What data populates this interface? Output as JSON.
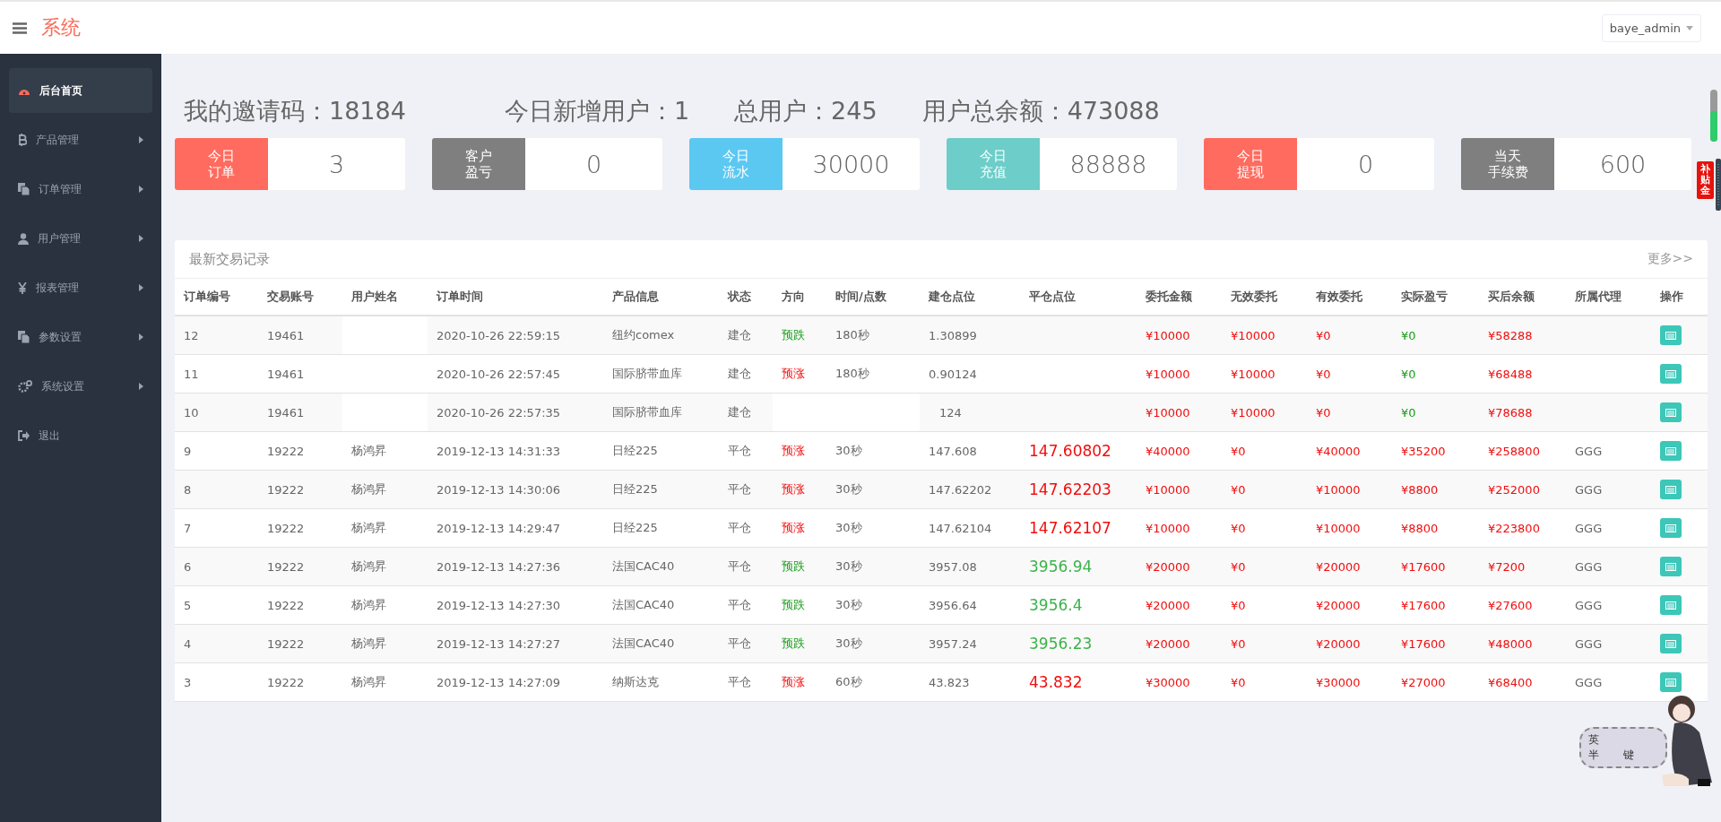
{
  "header": {
    "title": "系统",
    "user_menu": "baye_admin"
  },
  "sidebar": {
    "items": [
      {
        "label": "后台首页",
        "kind": "dashboard",
        "selected": true,
        "has_submenu": false
      },
      {
        "label": "产品管理",
        "kind": "bitcoin",
        "selected": false,
        "has_submenu": true
      },
      {
        "label": "订单管理",
        "kind": "files",
        "selected": false,
        "has_submenu": true
      },
      {
        "label": "用户管理",
        "kind": "user",
        "selected": false,
        "has_submenu": true
      },
      {
        "label": "报表管理",
        "kind": "yen",
        "selected": false,
        "has_submenu": true
      },
      {
        "label": "参数设置",
        "kind": "files",
        "selected": false,
        "has_submenu": true
      },
      {
        "label": "系统设置",
        "kind": "gears",
        "selected": false,
        "has_submenu": true
      },
      {
        "label": "退出",
        "kind": "exit",
        "selected": false,
        "has_submenu": false
      }
    ]
  },
  "summary": [
    {
      "label": "我的邀请码：",
      "value": "18184"
    },
    {
      "label": "今日新增用户：",
      "value": "1"
    },
    {
      "label": "总用户：",
      "value": "245"
    },
    {
      "label": "用户总余额：",
      "value": "473088"
    }
  ],
  "stat_cards": [
    {
      "label_lines": [
        "今日",
        "订单"
      ],
      "value": "3",
      "color": "#ff6b5e"
    },
    {
      "label_lines": [
        "客户",
        "盈亏"
      ],
      "value": "0",
      "color": "#7f7f7f"
    },
    {
      "label_lines": [
        "今日",
        "流水"
      ],
      "value": "30000",
      "color": "#5bc8f2"
    },
    {
      "label_lines": [
        "今日",
        "充值"
      ],
      "value": "88888",
      "color": "#6ccdc9"
    },
    {
      "label_lines": [
        "今日",
        "提现"
      ],
      "value": "0",
      "color": "#ff6b5e"
    },
    {
      "label_lines": [
        "当天",
        "手续费"
      ],
      "value": "600",
      "color": "#7f7f7f"
    }
  ],
  "trades": {
    "title": "最新交易记录",
    "more_link": "更多>>",
    "columns": [
      "订单编号",
      "交易账号",
      "用户姓名",
      "订单时间",
      "产品信息",
      "状态",
      "方向",
      "时间/点数",
      "建仓点位",
      "平仓点位",
      "委托金额",
      "无效委托",
      "有效委托",
      "实际盈亏",
      "买后余额",
      "所属代理",
      "操作"
    ],
    "rows": [
      {
        "id": "12",
        "account": "19461",
        "time": "2020-10-26 22:59:15",
        "product": "纽约comex",
        "status": "建仓",
        "direction": {
          "label": "预跌",
          "kind": "down"
        },
        "duration": "180秒",
        "open": "1.30899",
        "entrust": "¥10000",
        "invalid": "¥10000",
        "valid": "¥0",
        "profit": {
          "value": "¥0",
          "kind": "down"
        },
        "balance": "¥58288"
      },
      {
        "id": "11",
        "account": "19461",
        "time": "2020-10-26 22:57:45",
        "product": "国际脐带血库",
        "status": "建仓",
        "direction": {
          "label": "预涨",
          "kind": "up"
        },
        "duration": "180秒",
        "open": "0.90124",
        "entrust": "¥10000",
        "invalid": "¥10000",
        "valid": "¥0",
        "profit": {
          "value": "¥0",
          "kind": "down"
        },
        "balance": "¥68488"
      },
      {
        "id": "10",
        "account": "19461",
        "time": "2020-10-26 22:57:35",
        "product": "国际脐带血库",
        "status": "建仓",
        "open": "124",
        "entrust": "¥10000",
        "invalid": "¥10000",
        "valid": "¥0",
        "profit": {
          "value": "¥0",
          "kind": "down"
        },
        "balance": "¥78688"
      },
      {
        "id": "9",
        "account": "19222",
        "name": "杨鸿昇",
        "time": "2019-12-13 14:31:33",
        "product": "日经225",
        "status": "平仓",
        "direction": {
          "label": "预涨",
          "kind": "up"
        },
        "duration": "30秒",
        "open": "147.608",
        "close": {
          "value": "147.60802",
          "kind": "up"
        },
        "entrust": "¥40000",
        "invalid": "¥0",
        "valid": "¥40000",
        "profit": {
          "value": "¥35200",
          "kind": "up"
        },
        "balance": "¥258800",
        "agent": "GGG"
      },
      {
        "id": "8",
        "account": "19222",
        "name": "杨鸿昇",
        "time": "2019-12-13 14:30:06",
        "product": "日经225",
        "status": "平仓",
        "direction": {
          "label": "预涨",
          "kind": "up"
        },
        "duration": "30秒",
        "open": "147.62202",
        "close": {
          "value": "147.62203",
          "kind": "up"
        },
        "entrust": "¥10000",
        "invalid": "¥0",
        "valid": "¥10000",
        "profit": {
          "value": "¥8800",
          "kind": "up"
        },
        "balance": "¥252000",
        "agent": "GGG"
      },
      {
        "id": "7",
        "account": "19222",
        "name": "杨鸿昇",
        "time": "2019-12-13 14:29:47",
        "product": "日经225",
        "status": "平仓",
        "direction": {
          "label": "预涨",
          "kind": "up"
        },
        "duration": "30秒",
        "open": "147.62104",
        "close": {
          "value": "147.62107",
          "kind": "up"
        },
        "entrust": "¥10000",
        "invalid": "¥0",
        "valid": "¥10000",
        "profit": {
          "value": "¥8800",
          "kind": "up"
        },
        "balance": "¥223800",
        "agent": "GGG"
      },
      {
        "id": "6",
        "account": "19222",
        "name": "杨鸿昇",
        "time": "2019-12-13 14:27:36",
        "product": "法国CAC40",
        "status": "平仓",
        "direction": {
          "label": "预跌",
          "kind": "down"
        },
        "duration": "30秒",
        "open": "3957.08",
        "close": {
          "value": "3956.94",
          "kind": "down"
        },
        "entrust": "¥20000",
        "invalid": "¥0",
        "valid": "¥20000",
        "profit": {
          "value": "¥17600",
          "kind": "up"
        },
        "balance": "¥7200",
        "agent": "GGG"
      },
      {
        "id": "5",
        "account": "19222",
        "name": "杨鸿昇",
        "time": "2019-12-13 14:27:30",
        "product": "法国CAC40",
        "status": "平仓",
        "direction": {
          "label": "预跌",
          "kind": "down"
        },
        "duration": "30秒",
        "open": "3956.64",
        "close": {
          "value": "3956.4",
          "kind": "down"
        },
        "entrust": "¥20000",
        "invalid": "¥0",
        "valid": "¥20000",
        "profit": {
          "value": "¥17600",
          "kind": "up"
        },
        "balance": "¥27600",
        "agent": "GGG"
      },
      {
        "id": "4",
        "account": "19222",
        "name": "杨鸿昇",
        "time": "2019-12-13 14:27:27",
        "product": "法国CAC40",
        "status": "平仓",
        "direction": {
          "label": "预跌",
          "kind": "down"
        },
        "duration": "30秒",
        "open": "3957.24",
        "close": {
          "value": "3956.23",
          "kind": "down"
        },
        "entrust": "¥20000",
        "invalid": "¥0",
        "valid": "¥20000",
        "profit": {
          "value": "¥17600",
          "kind": "up"
        },
        "balance": "¥48000",
        "agent": "GGG"
      },
      {
        "id": "3",
        "account": "19222",
        "name": "杨鸿昇",
        "time": "2019-12-13 14:27:09",
        "product": "纳斯达克",
        "status": "平仓",
        "direction": {
          "label": "预涨",
          "kind": "up"
        },
        "duration": "60秒",
        "open": "43.823",
        "close": {
          "value": "43.832",
          "kind": "up"
        },
        "entrust": "¥30000",
        "invalid": "¥0",
        "valid": "¥30000",
        "profit": {
          "value": "¥27000",
          "kind": "up"
        },
        "balance": "¥68400",
        "agent": "GGG"
      }
    ]
  },
  "side_badge": {
    "label": "补贴金"
  },
  "ime_widget": {
    "chars": [
      "英",
      "半",
      "键"
    ]
  }
}
